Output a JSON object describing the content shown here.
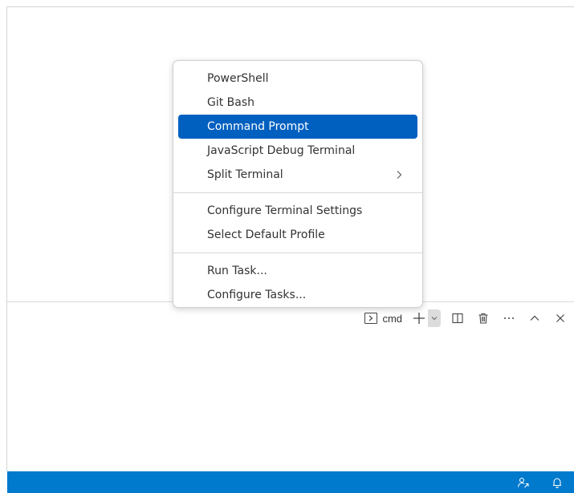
{
  "menu": {
    "groups": [
      [
        {
          "label": "PowerShell"
        },
        {
          "label": "Git Bash"
        },
        {
          "label": "Command Prompt",
          "highlighted": true
        },
        {
          "label": "JavaScript Debug Terminal"
        },
        {
          "label": "Split Terminal",
          "submenu": ">"
        }
      ],
      [
        {
          "label": "Configure Terminal Settings"
        },
        {
          "label": "Select Default Profile"
        }
      ],
      [
        {
          "label": "Run Task..."
        },
        {
          "label": "Configure Tasks..."
        }
      ]
    ]
  },
  "panel": {
    "toolbar": {
      "terminal_label": "cmd",
      "icons": [
        "terminal-icon",
        "plus-icon",
        "chevron-down-icon",
        "split-icon",
        "trash-icon",
        "more-icon",
        "chevron-up-icon",
        "close-icon"
      ]
    }
  },
  "status_bar": {
    "icons": [
      "remote-feedback-icon",
      "bell-icon"
    ]
  },
  "colors": {
    "accent": "#007acc",
    "menu_highlight": "#0060c0"
  }
}
